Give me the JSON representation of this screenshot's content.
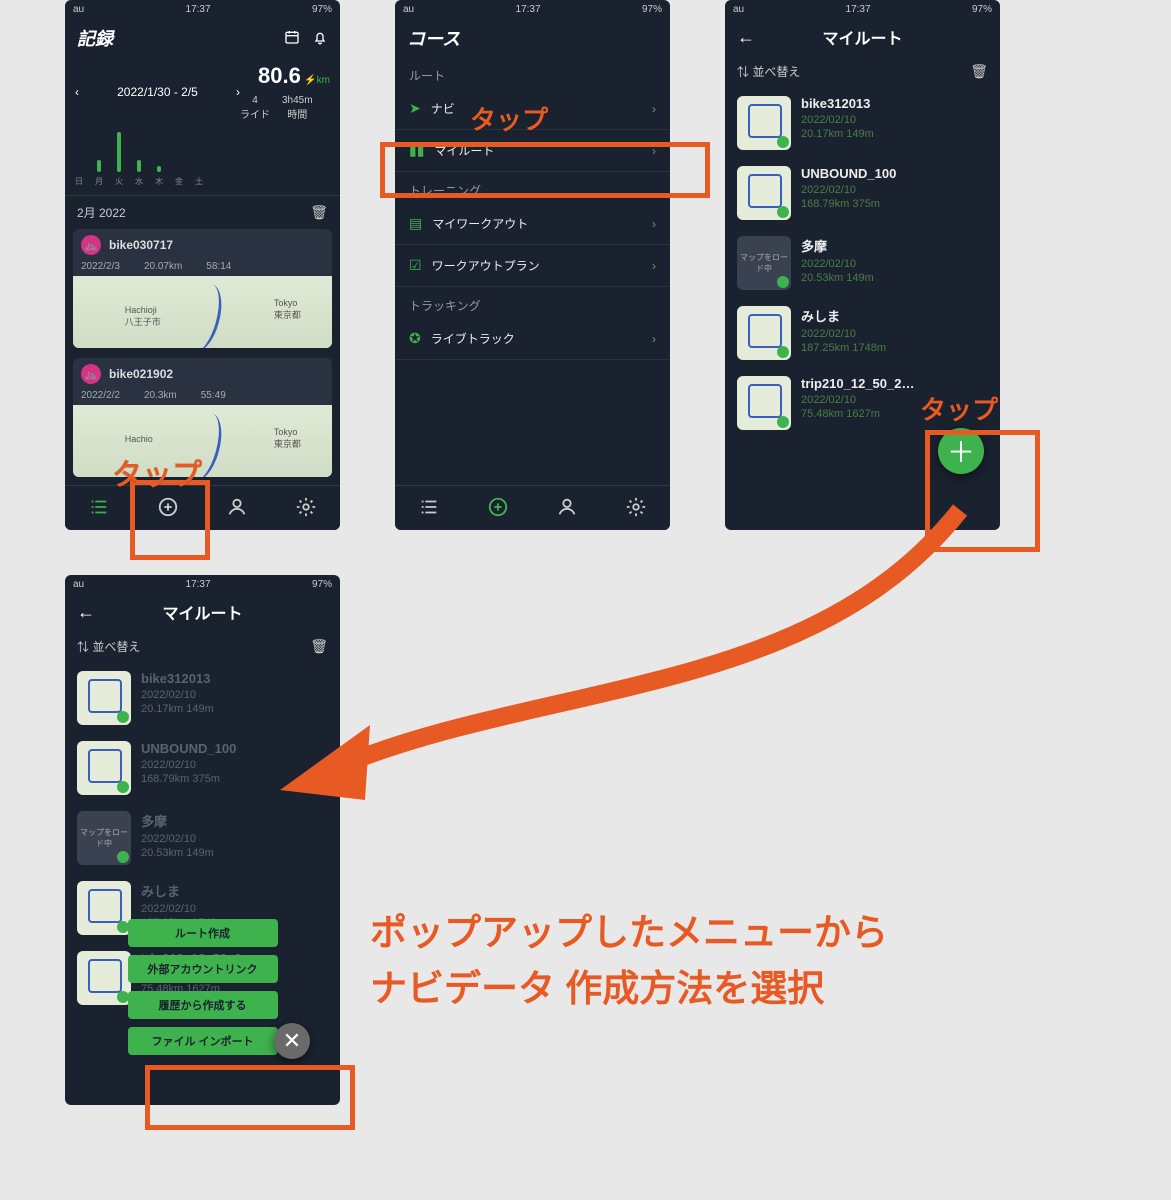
{
  "status": {
    "carrier": "au",
    "time": "17:37",
    "battery": "97%"
  },
  "screen1": {
    "title": "記録",
    "week": "2022/1/30 - 2/5",
    "total_km": "80.6",
    "km_unit": "km",
    "rides_n": "4",
    "rides_label": "ライド",
    "time_val": "3h45m",
    "time_label": "時間",
    "dows": [
      "日",
      "月",
      "火",
      "水",
      "木",
      "金",
      "土"
    ],
    "month": "2月 2022",
    "cards": [
      {
        "name": "bike030717",
        "date": "2022/2/3",
        "km": "20.07km",
        "dur": "58:14",
        "L": "Hachioji\n八王子市",
        "R": "Tokyo\n東京都"
      },
      {
        "name": "bike021902",
        "date": "2022/2/2",
        "km": "20.3km",
        "dur": "55:49",
        "L": "Hachio",
        "R": "Tokyo\n東京都"
      }
    ]
  },
  "screen2": {
    "title": "コース",
    "sec1": "ルート",
    "rows1": [
      {
        "icon": "➤",
        "label": "ナビ"
      },
      {
        "icon": "▮▮",
        "label": "マイルート"
      }
    ],
    "sec2": "トレーニング",
    "rows2": [
      {
        "icon": "▤",
        "label": "マイワークアウト"
      },
      {
        "icon": "☑",
        "label": "ワークアウトプラン"
      }
    ],
    "sec3": "トラッキング",
    "rows3": [
      {
        "icon": "✪",
        "label": "ライブトラック"
      }
    ]
  },
  "screen3": {
    "title": "マイルート",
    "sort": "並べ替え",
    "routes": [
      {
        "name": "bike312013",
        "date": "2022/02/10",
        "dist": "20.17km 149m",
        "loading": false
      },
      {
        "name": "UNBOUND_100",
        "date": "2022/02/10",
        "dist": "168.79km 375m",
        "loading": false
      },
      {
        "name": "多摩",
        "date": "2022/02/10",
        "dist": "20.53km 149m",
        "loading": true,
        "loadtext": "マップをロード中"
      },
      {
        "name": "みしま",
        "date": "2022/02/10",
        "dist": "187.25km 1748m",
        "loading": false
      },
      {
        "name": "trip210_12_50_2…",
        "date": "2022/02/10",
        "dist": "75.48km 1627m",
        "loading": false
      }
    ]
  },
  "screen4": {
    "popup": [
      "ルート作成",
      "外部アカウントリンク",
      "履歴から作成する",
      "ファイル インポート"
    ]
  },
  "anno": {
    "tap": "タップ",
    "big": "ポップアップしたメニューから\nナビデータ 作成方法を選択"
  }
}
